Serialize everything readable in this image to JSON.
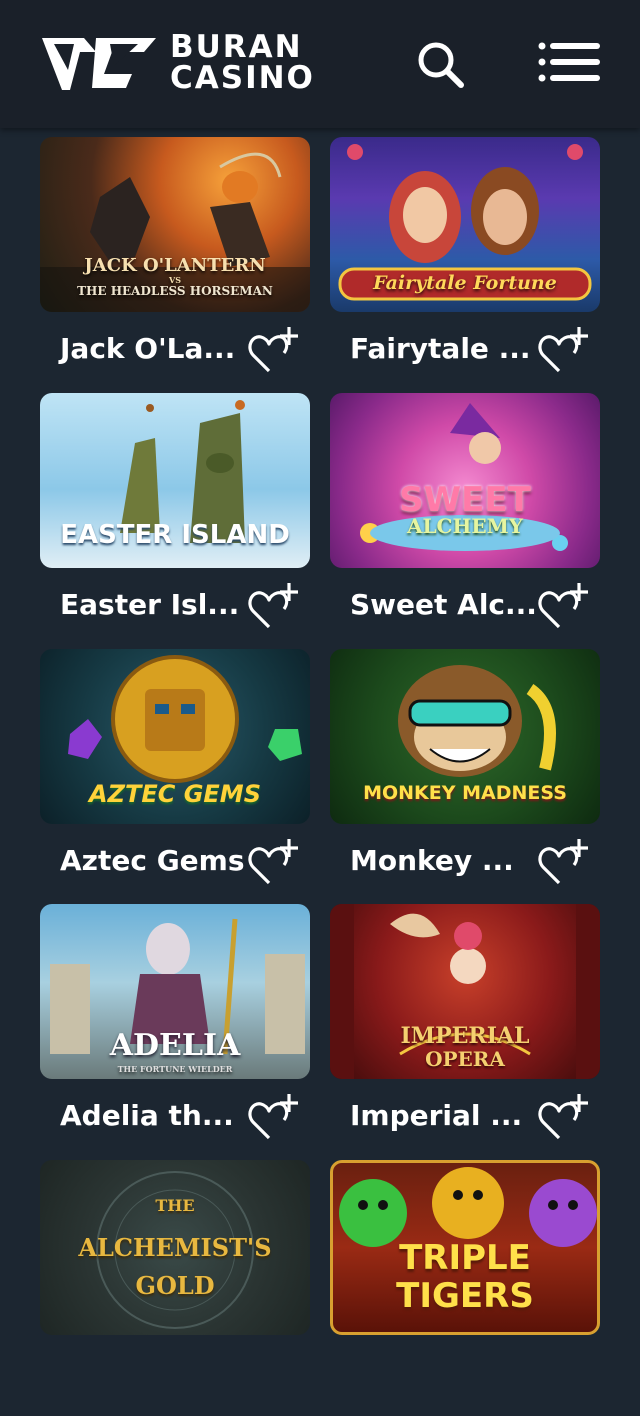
{
  "header": {
    "logo_line1": "BURAN",
    "logo_line2": "CASINO",
    "search_icon": "search-icon",
    "menu_icon": "hamburger-menu-icon"
  },
  "games": [
    {
      "name": "Jack O'La...",
      "art": "JACK O'LANTERN",
      "art_sub": "THE HEADLESS HORSEMAN",
      "art_vs": "VS"
    },
    {
      "name": "Fairytale ...",
      "art": "Fairytale Fortune",
      "art_sub": ""
    },
    {
      "name": "Easter Isl...",
      "art": "EASTER ISLAND",
      "art_sub": ""
    },
    {
      "name": "Sweet Alc...",
      "art": "SWEET",
      "art_sub": "ALCHEMY"
    },
    {
      "name": "Aztec Gems",
      "art": "AZTEC GEMS",
      "art_sub": ""
    },
    {
      "name": "Monkey ...",
      "art": "MONKEY MADNESS",
      "art_sub": ""
    },
    {
      "name": "Adelia th...",
      "art": "ADELIA",
      "art_sub": "THE FORTUNE WIELDER"
    },
    {
      "name": "Imperial ...",
      "art": "IMPERIAL",
      "art_sub": "OPERA"
    },
    {
      "name": "",
      "art": "THE",
      "art_sub": "ALCHEMIST'S GOLD"
    },
    {
      "name": "",
      "art": "TRIPLE",
      "art_sub": "TIGERS"
    }
  ],
  "colors": {
    "background": "#1c2631",
    "header": "#1a2029",
    "text": "#ffffff"
  },
  "favorite_icon": "heart-plus-icon"
}
